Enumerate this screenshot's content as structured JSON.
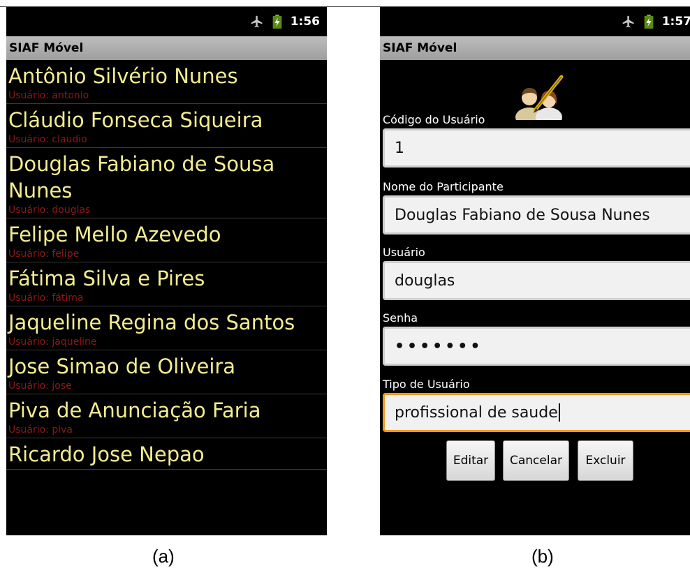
{
  "panel_a": {
    "status": {
      "time": "1:56"
    },
    "title": "SIAF Móvel",
    "items": [
      {
        "name": "Antônio Silvério Nunes",
        "user": "Usuário: antonio"
      },
      {
        "name": "Cláudio Fonseca Siqueira",
        "user": "Usuário: claudio"
      },
      {
        "name": "Douglas Fabiano de Sousa Nunes",
        "user": "Usuário: douglas"
      },
      {
        "name": "Felipe Mello Azevedo",
        "user": "Usuário: felipe"
      },
      {
        "name": "Fátima Silva e Pires",
        "user": "Usuário: fátima"
      },
      {
        "name": "Jaqueline Regina dos Santos",
        "user": "Usuário: jaqueline"
      },
      {
        "name": "Jose Simao de Oliveira",
        "user": "Usuário: jose"
      },
      {
        "name": "Piva de Anunciação Faria",
        "user": "Usuário: piva"
      },
      {
        "name": "Ricardo Jose Nepao",
        "user": ""
      }
    ]
  },
  "panel_b": {
    "status": {
      "time": "1:57"
    },
    "title": "SIAF Móvel",
    "fields": {
      "codigo": {
        "label": "Código do Usuário",
        "value": "1"
      },
      "nome": {
        "label": "Nome do Participante",
        "value": "Douglas Fabiano de Sousa Nunes"
      },
      "usuario": {
        "label": "Usuário",
        "value": "douglas"
      },
      "senha": {
        "label": "Senha",
        "value": "•••••••"
      },
      "tipo": {
        "label": "Tipo de Usuário",
        "value": "profissional de saude"
      }
    },
    "buttons": {
      "editar": "Editar",
      "cancelar": "Cancelar",
      "excluir": "Excluir"
    }
  },
  "captions": {
    "a": "(a)",
    "b": "(b)"
  },
  "colors": {
    "item_name": "#f3ec8f",
    "item_user": "#8c1818",
    "focus_border": "#f29b1b"
  },
  "icons": [
    "airplane-mode-icon",
    "battery-charging-icon",
    "user-edit-avatar-icon"
  ]
}
